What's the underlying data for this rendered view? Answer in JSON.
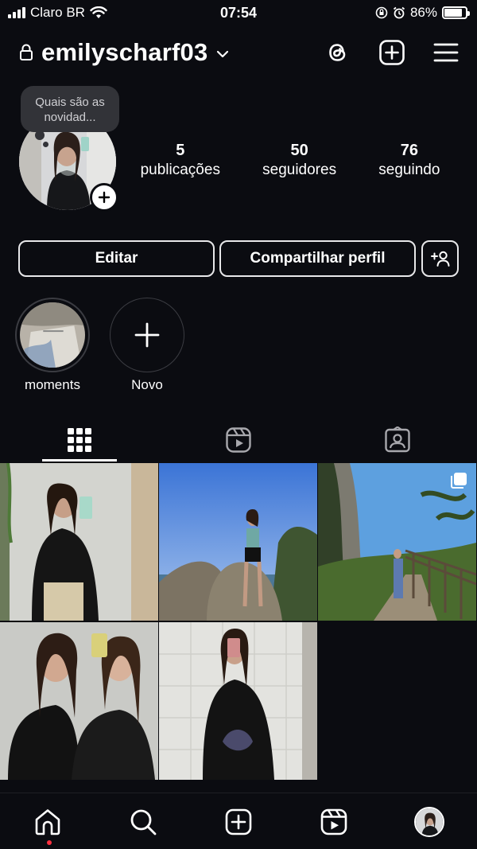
{
  "status_bar": {
    "carrier": "Claro BR",
    "time": "07:54",
    "battery_percent": "86%",
    "battery_level": 0.86
  },
  "header": {
    "username": "emilyscharf03"
  },
  "note": {
    "text": "Quais são as novidad..."
  },
  "stats": [
    {
      "count": "5",
      "label": "publicações"
    },
    {
      "count": "50",
      "label": "seguidores"
    },
    {
      "count": "76",
      "label": "seguindo"
    }
  ],
  "buttons": {
    "edit": "Editar",
    "share": "Compartilhar perfil"
  },
  "highlights": [
    {
      "label": "moments"
    },
    {
      "label": "Novo"
    }
  ],
  "tabs": [
    {
      "icon": "grid-icon",
      "active": true
    },
    {
      "icon": "reels-icon",
      "active": false
    },
    {
      "icon": "tagged-icon",
      "active": false
    }
  ],
  "posts_count": 5,
  "bottom_nav": [
    "home-icon",
    "search-icon",
    "create-icon",
    "reels-icon",
    "profile-avatar"
  ],
  "colors": {
    "background": "#0b0c11",
    "notification_dot": "#ff3040",
    "note_bubble": "#323338"
  }
}
